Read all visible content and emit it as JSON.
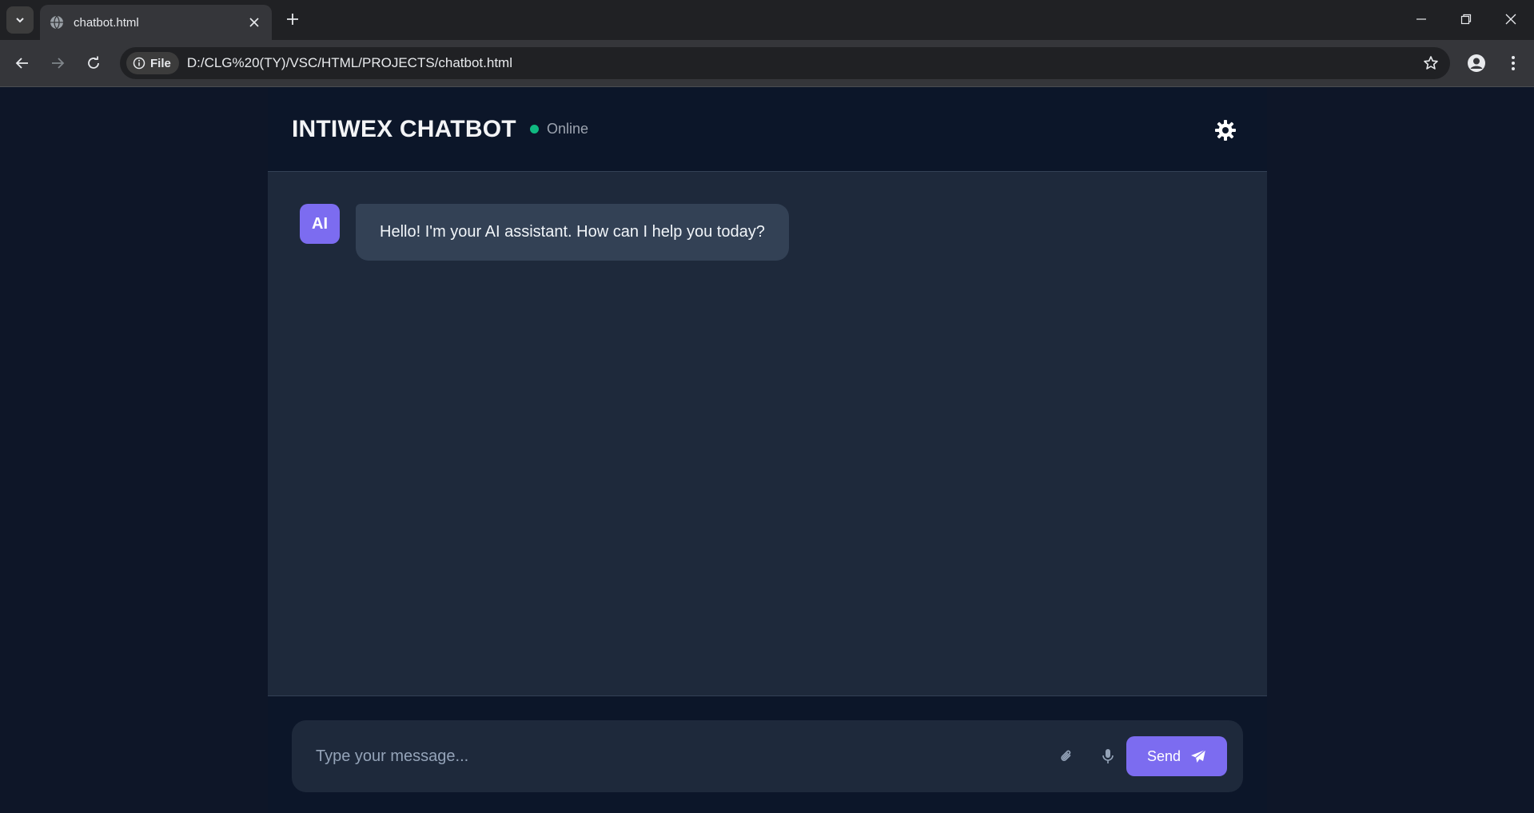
{
  "browser": {
    "tab_title": "chatbot.html",
    "site_chip_label": "File",
    "url": "D:/CLG%20(TY)/VSC/HTML/PROJECTS/chatbot.html"
  },
  "app": {
    "title": "INTIWEX CHATBOT",
    "status": "Online",
    "status_color": "#10b981",
    "accent_color": "#7c6cf0"
  },
  "messages": [
    {
      "sender": "AI",
      "text": "Hello! I'm your AI assistant. How can I help you today?"
    }
  ],
  "composer": {
    "placeholder": "Type your message...",
    "value": "",
    "send_label": "Send"
  },
  "icons": {
    "theme": "gear-icon",
    "attach": "paperclip-icon",
    "mic": "microphone-icon",
    "send": "paper-plane-icon"
  }
}
